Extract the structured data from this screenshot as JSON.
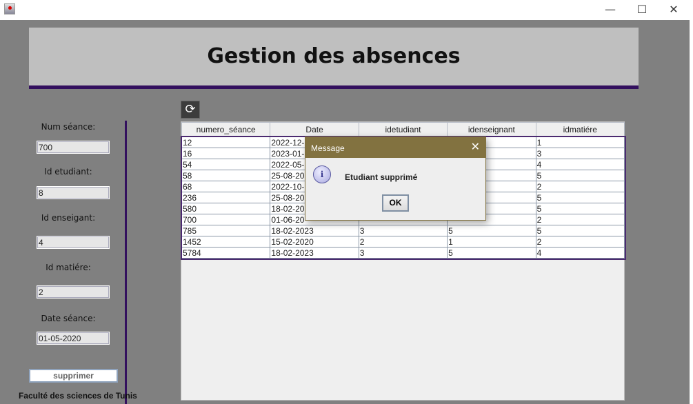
{
  "window": {
    "minimize": "—",
    "maximize": "☐",
    "close": "✕"
  },
  "header": {
    "title": "Gestion des absences"
  },
  "form": {
    "num_seance_label": "Num séance:",
    "num_seance": "700",
    "id_etudiant_label": "Id etudiant:",
    "id_etudiant": "8",
    "id_enseignant_label": "Id enseigant:",
    "id_enseignant": "4",
    "id_matiere_label": "Id matiére:",
    "id_matiere": "2",
    "date_label": "Date séance:",
    "date": "01-05-2020",
    "delete_button": "supprimer"
  },
  "footer": "Faculté des sciences de Tunis",
  "refresh_icon": "⟳",
  "table": {
    "columns": [
      "numero_séance",
      "Date",
      "idetudiant",
      "idenseignant",
      "idmatiére"
    ],
    "rows": [
      [
        "12",
        "2022-12-",
        "",
        "",
        "1"
      ],
      [
        "16",
        "2023-01-",
        "",
        "",
        "3"
      ],
      [
        "54",
        "2022-05-",
        "",
        "",
        "4"
      ],
      [
        "58",
        "25-08-20",
        "",
        "",
        "5"
      ],
      [
        "68",
        "2022-10-",
        "",
        "",
        "2"
      ],
      [
        "236",
        "25-08-20",
        "",
        "",
        "5"
      ],
      [
        "580",
        "18-02-20",
        "",
        "",
        "5"
      ],
      [
        "700",
        "01-06-20",
        "",
        "",
        "2"
      ],
      [
        "785",
        "18-02-2023",
        "3",
        "5",
        "5"
      ],
      [
        "1452",
        "15-02-2020",
        "2",
        "1",
        "2"
      ],
      [
        "5784",
        "18-02-2023",
        "3",
        "5",
        "4"
      ]
    ]
  },
  "dialog": {
    "title": "Message",
    "close": "✕",
    "icon": "i",
    "message": "Etudiant supprimé",
    "ok": "OK",
    "title_color": "#827240"
  }
}
